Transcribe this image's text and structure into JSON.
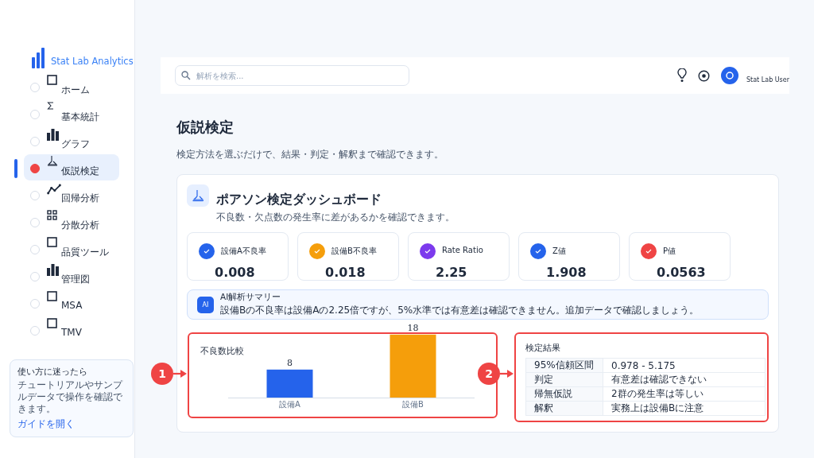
{
  "sidebar": {
    "logo": "Stat Lab Analytics",
    "items": [
      {
        "label": "ホーム",
        "kind": "square",
        "selected": false
      },
      {
        "label": "基本統計",
        "kind": "sigma",
        "selected": false
      },
      {
        "label": "グラフ",
        "kind": "bars",
        "selected": false
      },
      {
        "label": "仮説検定",
        "kind": "flask",
        "selected": true
      },
      {
        "label": "回帰分析",
        "kind": "line",
        "selected": false
      },
      {
        "label": "分散分析",
        "kind": "grid",
        "selected": false
      },
      {
        "label": "品質ツール",
        "kind": "square",
        "selected": false
      },
      {
        "label": "管理図",
        "kind": "bars",
        "selected": false
      },
      {
        "label": "MSA",
        "kind": "square",
        "selected": false
      },
      {
        "label": "TMV",
        "kind": "square",
        "selected": false
      }
    ],
    "help": {
      "title": "使い方に迷ったら",
      "text": "チュートリアルやサンプルデータで操作を確認できます。",
      "link": "ガイドを開く"
    }
  },
  "header": {
    "search": {
      "placeholder": "解析を検索..."
    },
    "user": "Stat Lab User"
  },
  "page": {
    "title": "仮説検定",
    "subtitle": "検定方法を選ぶだけで、結果・判定・解釈まで確認できます。"
  },
  "dashboard": {
    "title": "ポアソン検定ダッシュボード",
    "subtitle": "不良数・欠点数の発生率に差があるかを確認できます。",
    "kpis": [
      {
        "label": "設備A不良率",
        "value": "0.008",
        "color": "#2563eb"
      },
      {
        "label": "設備B不良率",
        "value": "0.018",
        "color": "#f59e0b"
      },
      {
        "label": "Rate Ratio",
        "value": "2.25",
        "color": "#7c3aed"
      },
      {
        "label": "Z値",
        "value": "1.908",
        "color": "#2563eb"
      },
      {
        "label": "P値",
        "value": "0.0563",
        "color": "#ef4444"
      }
    ],
    "ai": {
      "badge": "AI",
      "title": "AI解析サマリー",
      "text": "設備Bの不良率は設備Aの2.25倍ですが、5%水準では有意差は確認できません。追加データで確認しましょう。"
    },
    "chart": {
      "annotation": "1",
      "chart_data": {
        "type": "bar",
        "title": "不良数比較",
        "categories": [
          "設備A",
          "設備B"
        ],
        "values": [
          8,
          18
        ],
        "data_labels": true
      }
    },
    "results": {
      "annotation": "2",
      "title": "検定結果",
      "rows": [
        {
          "label": "95%信頼区間",
          "value": "0.978 - 5.175"
        },
        {
          "label": "判定",
          "value": "有意差は確認できない"
        },
        {
          "label": "帰無仮説",
          "value": "2群の発生率は等しい"
        },
        {
          "label": "解釈",
          "value": "実務上は設備Bに注意"
        }
      ]
    }
  }
}
